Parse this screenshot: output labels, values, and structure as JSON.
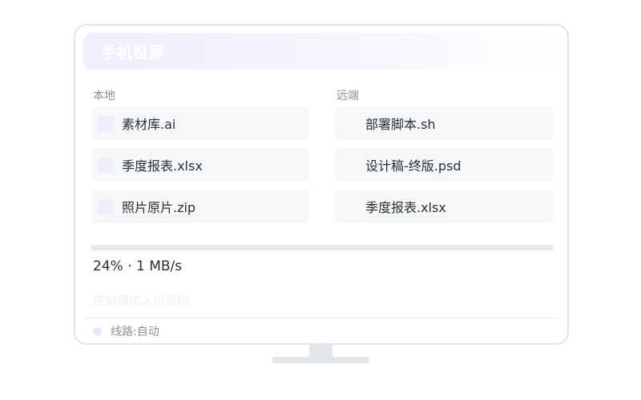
{
  "header": {
    "title": "手机投屏"
  },
  "local": {
    "label": "本地",
    "files": [
      {
        "name": "素材库.ai"
      },
      {
        "name": "季度报表.xlsx"
      },
      {
        "name": "照片原片.zip"
      }
    ]
  },
  "remote": {
    "label": "远端",
    "files": [
      {
        "name": "部署脚本.sh"
      },
      {
        "name": "设计稿-终版.psd"
      },
      {
        "name": "季度报表.xlsx"
      }
    ]
  },
  "transfer": {
    "progress": 0.24,
    "status_text": "24% · 1 MB/s"
  },
  "code_input": {
    "value": "",
    "placeholder": "控制端填入识别码"
  },
  "status": {
    "route_text": "线路:自动"
  },
  "colors": {
    "accent_light": "#efedfb",
    "text_primary": "#2b2f36",
    "text_muted": "#8a8f99",
    "frame": "#e2e5ea"
  }
}
